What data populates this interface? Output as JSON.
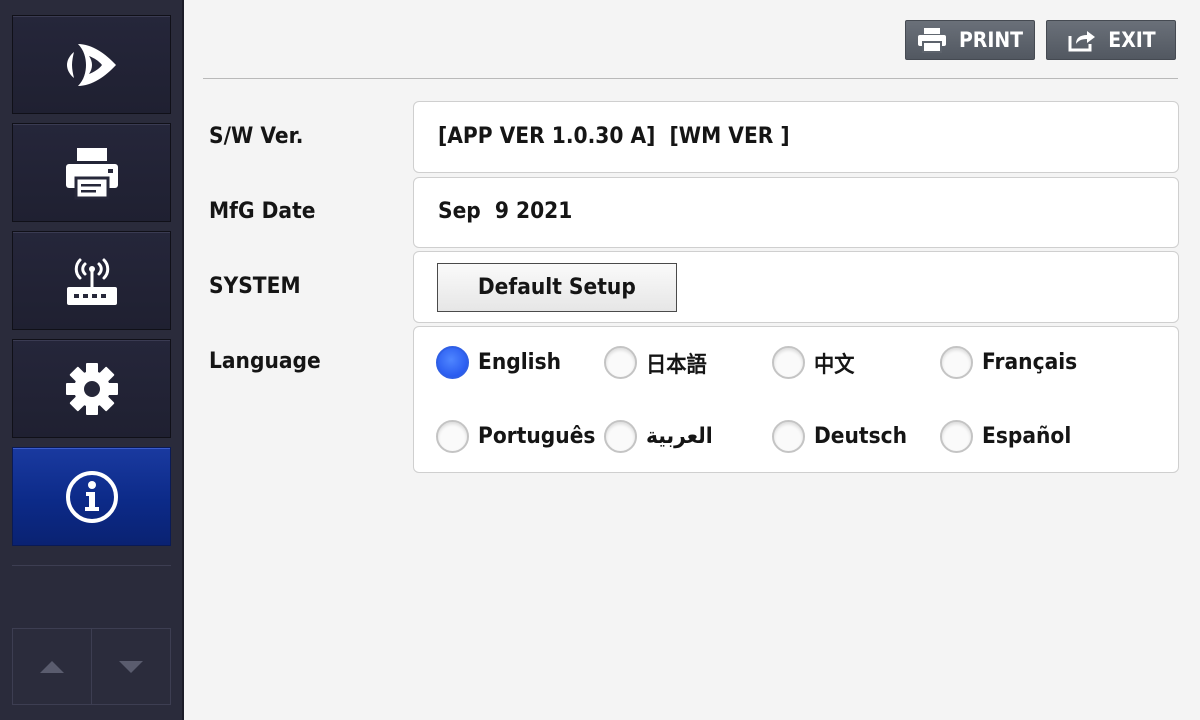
{
  "toolbar": {
    "print_label": "PRINT",
    "exit_label": "EXIT"
  },
  "sidebar": {
    "items": [
      {
        "icon": "brand-logo-icon",
        "active": false
      },
      {
        "icon": "printer-icon",
        "active": false
      },
      {
        "icon": "wireless-router-icon",
        "active": false
      },
      {
        "icon": "gear-icon",
        "active": false
      },
      {
        "icon": "info-icon",
        "active": true
      }
    ],
    "scroll": {
      "up_icon": "triangle-up-icon",
      "down_icon": "triangle-down-icon"
    }
  },
  "info": {
    "sw_ver_label": "S/W Ver.",
    "sw_ver_value": "[APP VER 1.0.30 A]  [WM VER ]",
    "mfg_date_label": "MfG Date",
    "mfg_date_value": "Sep  9 2021",
    "system_label": "SYSTEM",
    "default_setup_label": "Default Setup",
    "language_label": "Language"
  },
  "languages": {
    "options": [
      "English",
      "日本語",
      "中文",
      "Français",
      "Português",
      "العربية",
      "Deutsch",
      "Español"
    ],
    "selected": "English"
  },
  "colors": {
    "sidebar_bg": "#2a2b3b",
    "active_nav": "#0c2a88",
    "radio_checked": "#2a5cf0",
    "top_button": "#5d636c"
  }
}
